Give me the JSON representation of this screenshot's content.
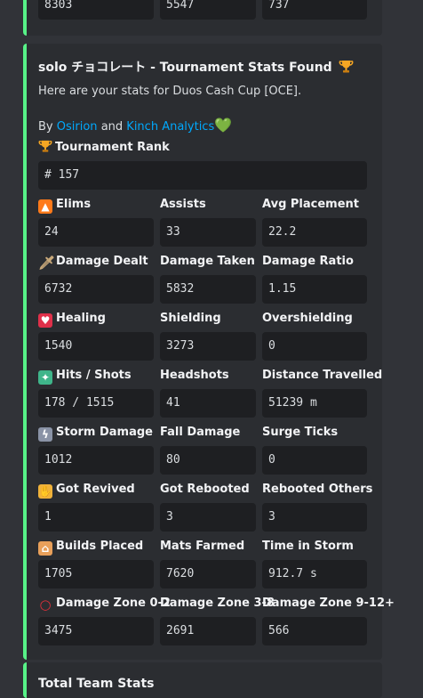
{
  "top_row": [
    "8303",
    "5547",
    "737"
  ],
  "embed": {
    "title": "solo チョコレート - Tournament Stats Found",
    "title_icon": "trophy-icon",
    "description": "Here are your stats for Duos Cash Cup [OCE].",
    "by_prefix": "By",
    "link1": "Osirion",
    "and_text": "and",
    "link2": "Kinch Analytics",
    "heart": "💚",
    "rank_label": "Tournament Rank",
    "rank_value": "# 157",
    "rows": [
      {
        "icon": "fire-icon",
        "cells": [
          {
            "label": "Elims",
            "value": "24"
          },
          {
            "label": "Assists",
            "value": "33"
          },
          {
            "label": "Avg Placement",
            "value": "22.2"
          }
        ]
      },
      {
        "icon": "dagger-icon",
        "cells": [
          {
            "label": "Damage Dealt",
            "value": "6732"
          },
          {
            "label": "Damage Taken",
            "value": "5832"
          },
          {
            "label": "Damage Ratio",
            "value": "1.15"
          }
        ]
      },
      {
        "icon": "heart-bandage-icon",
        "cells": [
          {
            "label": "Healing",
            "value": "1540"
          },
          {
            "label": "Shielding",
            "value": "3273"
          },
          {
            "label": "Overshielding",
            "value": "0"
          }
        ]
      },
      {
        "icon": "water-gun-icon",
        "cells": [
          {
            "label": "Hits / Shots",
            "value": "178 / 1515"
          },
          {
            "label": "Headshots",
            "value": "41"
          },
          {
            "label": "Distance Travelled",
            "value": "51239 m"
          }
        ]
      },
      {
        "icon": "storm-cloud-icon",
        "cells": [
          {
            "label": "Storm Damage",
            "value": "1012"
          },
          {
            "label": "Fall Damage",
            "value": "80"
          },
          {
            "label": "Surge Ticks",
            "value": "0"
          }
        ]
      },
      {
        "icon": "handshake-icon",
        "cells": [
          {
            "label": "Got Revived",
            "value": "1"
          },
          {
            "label": "Got Rebooted",
            "value": "3"
          },
          {
            "label": "Rebooted Others",
            "value": "3"
          }
        ]
      },
      {
        "icon": "house-icon",
        "cells": [
          {
            "label": "Builds Placed",
            "value": "1705"
          },
          {
            "label": "Mats Farmed",
            "value": "7620"
          },
          {
            "label": "Time in Storm",
            "value": "912.7 s"
          }
        ]
      },
      {
        "icon": "red-circle-icon",
        "cells": [
          {
            "label": "Damage Zone 0-2",
            "value": "3475"
          },
          {
            "label": "Damage Zone 3-8",
            "value": "2691"
          },
          {
            "label": "Damage Zone 9-12+",
            "value": "566"
          }
        ]
      }
    ]
  },
  "next_embed_title": "Total Team Stats"
}
